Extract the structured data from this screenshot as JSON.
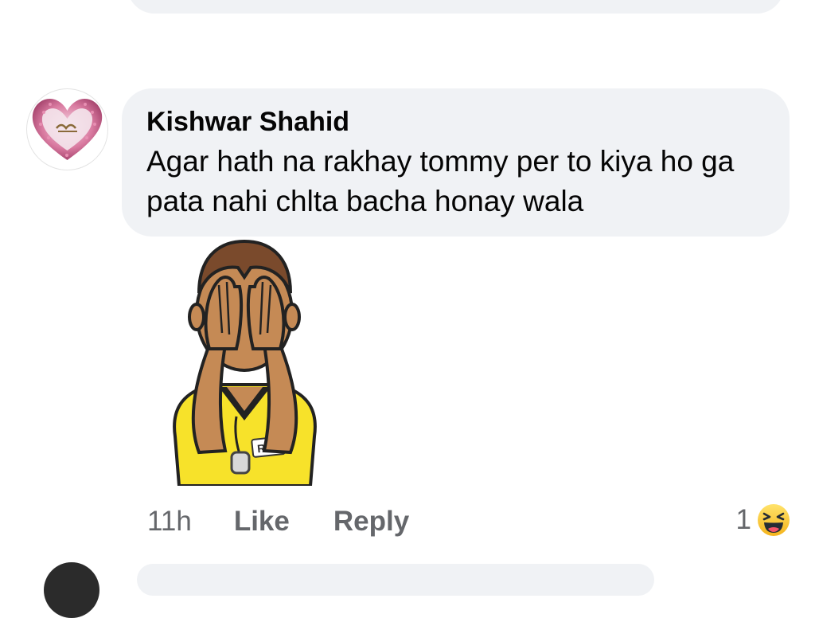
{
  "comment": {
    "author": "Kishwar Shahid",
    "text": "Agar hath na rakhay tommy per to kiya ho ga pata nahi chlta bacha honay wala",
    "time": "11h",
    "like_label": "Like",
    "reply_label": "Reply",
    "reaction_count": "1",
    "reaction_icon": "haha-emoji-icon",
    "sticker": "referee-covering-eyes-sticker",
    "sticker_badge": "REF"
  },
  "colors": {
    "bubble": "#f0f2f5",
    "text": "#050505",
    "meta": "#65676b",
    "referee_shirt": "#f7e22a",
    "skin": "#c58a55"
  }
}
